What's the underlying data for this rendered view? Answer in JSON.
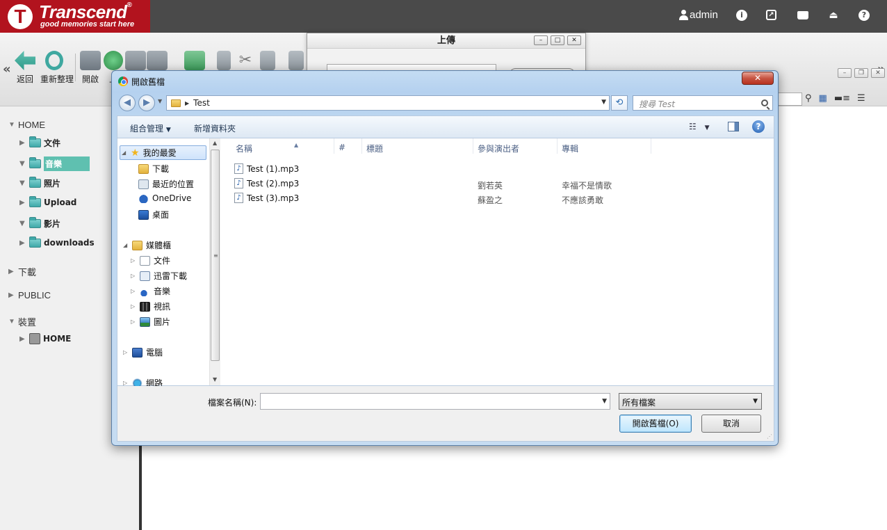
{
  "header": {
    "logo_letter": "T",
    "brand": "Transcend",
    "registered": "®",
    "tagline": "good memories start here",
    "user": "admin",
    "icons": [
      "info-icon",
      "external-link-icon",
      "drive-icon",
      "eject-icon",
      "help-icon"
    ]
  },
  "toolbar": {
    "back_label": "返回",
    "refresh_label": "重新整理",
    "open_label": "開啟",
    "upload_label": "上",
    "prev_nav": "«",
    "next_nav": "»"
  },
  "sidebar": {
    "home_section": "HOME",
    "home_folders": [
      "文件",
      "音樂",
      "照片",
      "Upload",
      "影片",
      "downloads"
    ],
    "selected_folder": "音樂",
    "downloads_section": "下載",
    "public_section": "PUBLIC",
    "device_section": "裝置",
    "device_item": "HOME"
  },
  "upload_dialog": {
    "title": "上傳"
  },
  "open_dialog": {
    "title": "開啟舊檔",
    "close_symbol": "✕",
    "path": "Test",
    "search_placeholder": "搜尋 Test",
    "organize_label": "組合管理",
    "new_folder_label": "新增資料夾",
    "help_symbol": "?",
    "nav_pane": {
      "favorites": "我的最愛",
      "favorites_items": [
        "下載",
        "最近的位置",
        "OneDrive",
        "桌面"
      ],
      "libraries": "媒體櫃",
      "library_items": [
        "文件",
        "迅雷下載",
        "音樂",
        "視訊",
        "圖片"
      ],
      "computer": "電腦",
      "network": "網路"
    },
    "columns": {
      "name": "名稱",
      "number": "#",
      "title": "標題",
      "artist": "參與演出者",
      "album": "專輯"
    },
    "files": [
      {
        "name": "Test (1).mp3",
        "artist": "",
        "album": ""
      },
      {
        "name": "Test (2).mp3",
        "artist": "劉若英",
        "album": "幸福不是情歌"
      },
      {
        "name": "Test (3).mp3",
        "artist": "蘇盈之",
        "album": "不應該勇敢"
      }
    ],
    "filename_label": "檔案名稱(N):",
    "filename_value": "",
    "file_type": "所有檔案",
    "open_button": "開啟舊檔(O)",
    "cancel_button": "取消"
  }
}
